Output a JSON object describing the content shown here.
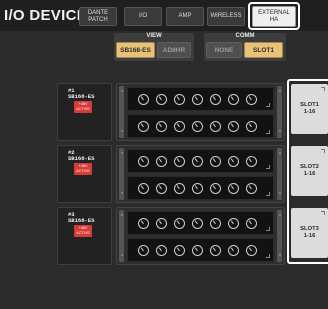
{
  "window": {
    "title": "I/O DEVICE"
  },
  "tabs": [
    {
      "label_line1": "DANTE",
      "label_line2": "PATCH"
    },
    {
      "label_line1": "I/O",
      "label_line2": ""
    },
    {
      "label_line1": "AMP",
      "label_line2": ""
    },
    {
      "label_line1": "WIRELESS",
      "label_line2": ""
    },
    {
      "label_line1": "EXTERNAL",
      "label_line2": "HA"
    }
  ],
  "view": {
    "label": "VIEW",
    "options": [
      "SB168-ES",
      "AD8HR"
    ],
    "selected": "SB168-ES"
  },
  "comm": {
    "label": "COMM",
    "options": [
      "NONE",
      "SLOT1"
    ],
    "selected": "SLOT1"
  },
  "devices": [
    {
      "number": "#1",
      "model": "SB168-ES",
      "badge_line1": "+48V",
      "badge_line2": "ACTIVE"
    },
    {
      "number": "#2",
      "model": "SB168-ES",
      "badge_line1": "+48V",
      "badge_line2": "ACTIVE"
    },
    {
      "number": "#3",
      "model": "SB168-ES",
      "badge_line1": "+48V",
      "badge_line2": "ACTIVE"
    }
  ],
  "slots": [
    {
      "label": "SLOT1",
      "range": "1-16"
    },
    {
      "label": "SLOT2",
      "range": "1-16"
    },
    {
      "label": "SLOT3",
      "range": "1-16"
    }
  ],
  "colors": {
    "accent_selected": "#e9c27a",
    "active_badge": "#d93a37",
    "highlight_frame": "#ffffff"
  }
}
